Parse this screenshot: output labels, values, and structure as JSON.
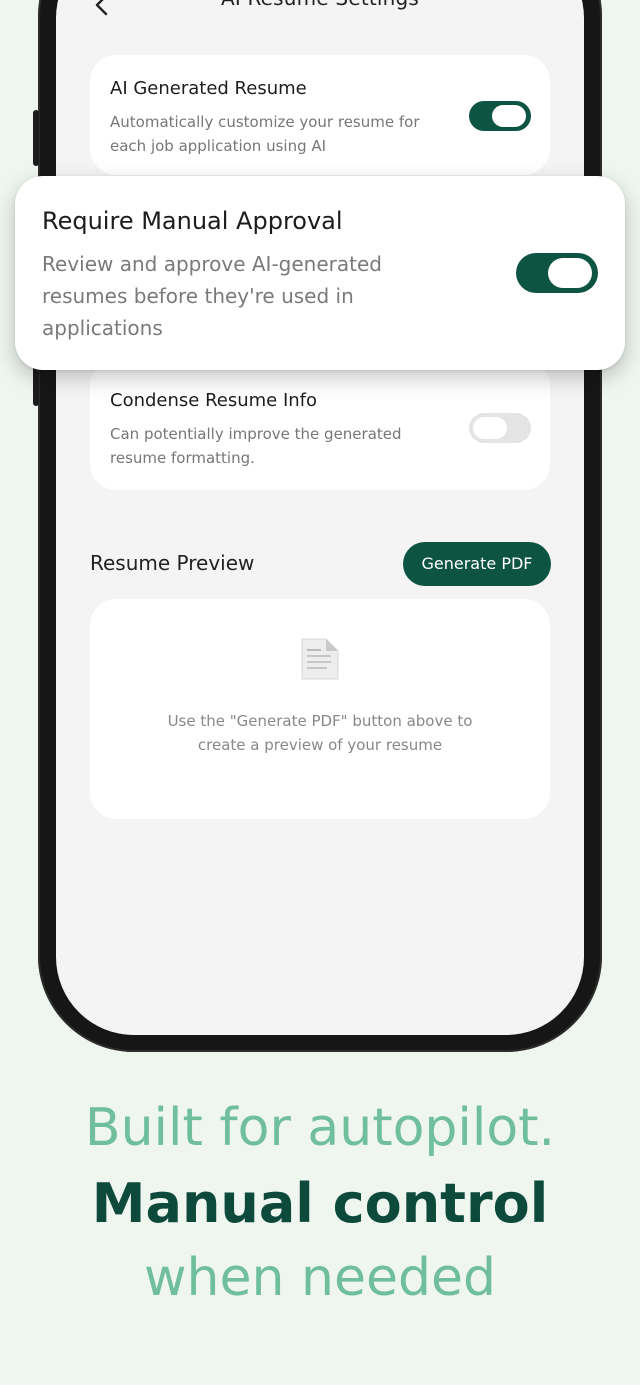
{
  "header": {
    "title": "AI Resume Settings"
  },
  "settings": [
    {
      "title": "AI Generated Resume",
      "desc1": "Automatically customize your resume for",
      "desc2": "each job application using AI",
      "enabled": true
    },
    {
      "title": "Require Manual Approval",
      "desc1": "Review and approve AI-generated",
      "desc2": "resumes before they're used in",
      "desc3": "applications",
      "enabled": true
    },
    {
      "title": "Condense Resume Info",
      "desc1": "Can potentially improve the generated",
      "desc2": "resume formatting.",
      "enabled": false
    }
  ],
  "preview": {
    "section_title": "Resume Preview",
    "button_label": "Generate PDF",
    "empty_line1": "Use the \"Generate PDF\" button above to",
    "empty_line2": "create a preview of your resume",
    "icon": "document-icon"
  },
  "tagline": {
    "line1": "Built for autopilot.",
    "line2": "Manual control",
    "line3": "when needed"
  },
  "colors": {
    "accent": "#0d5443",
    "tagline_light": "#6fbe9c",
    "tagline_dark": "#0d4a3c"
  }
}
